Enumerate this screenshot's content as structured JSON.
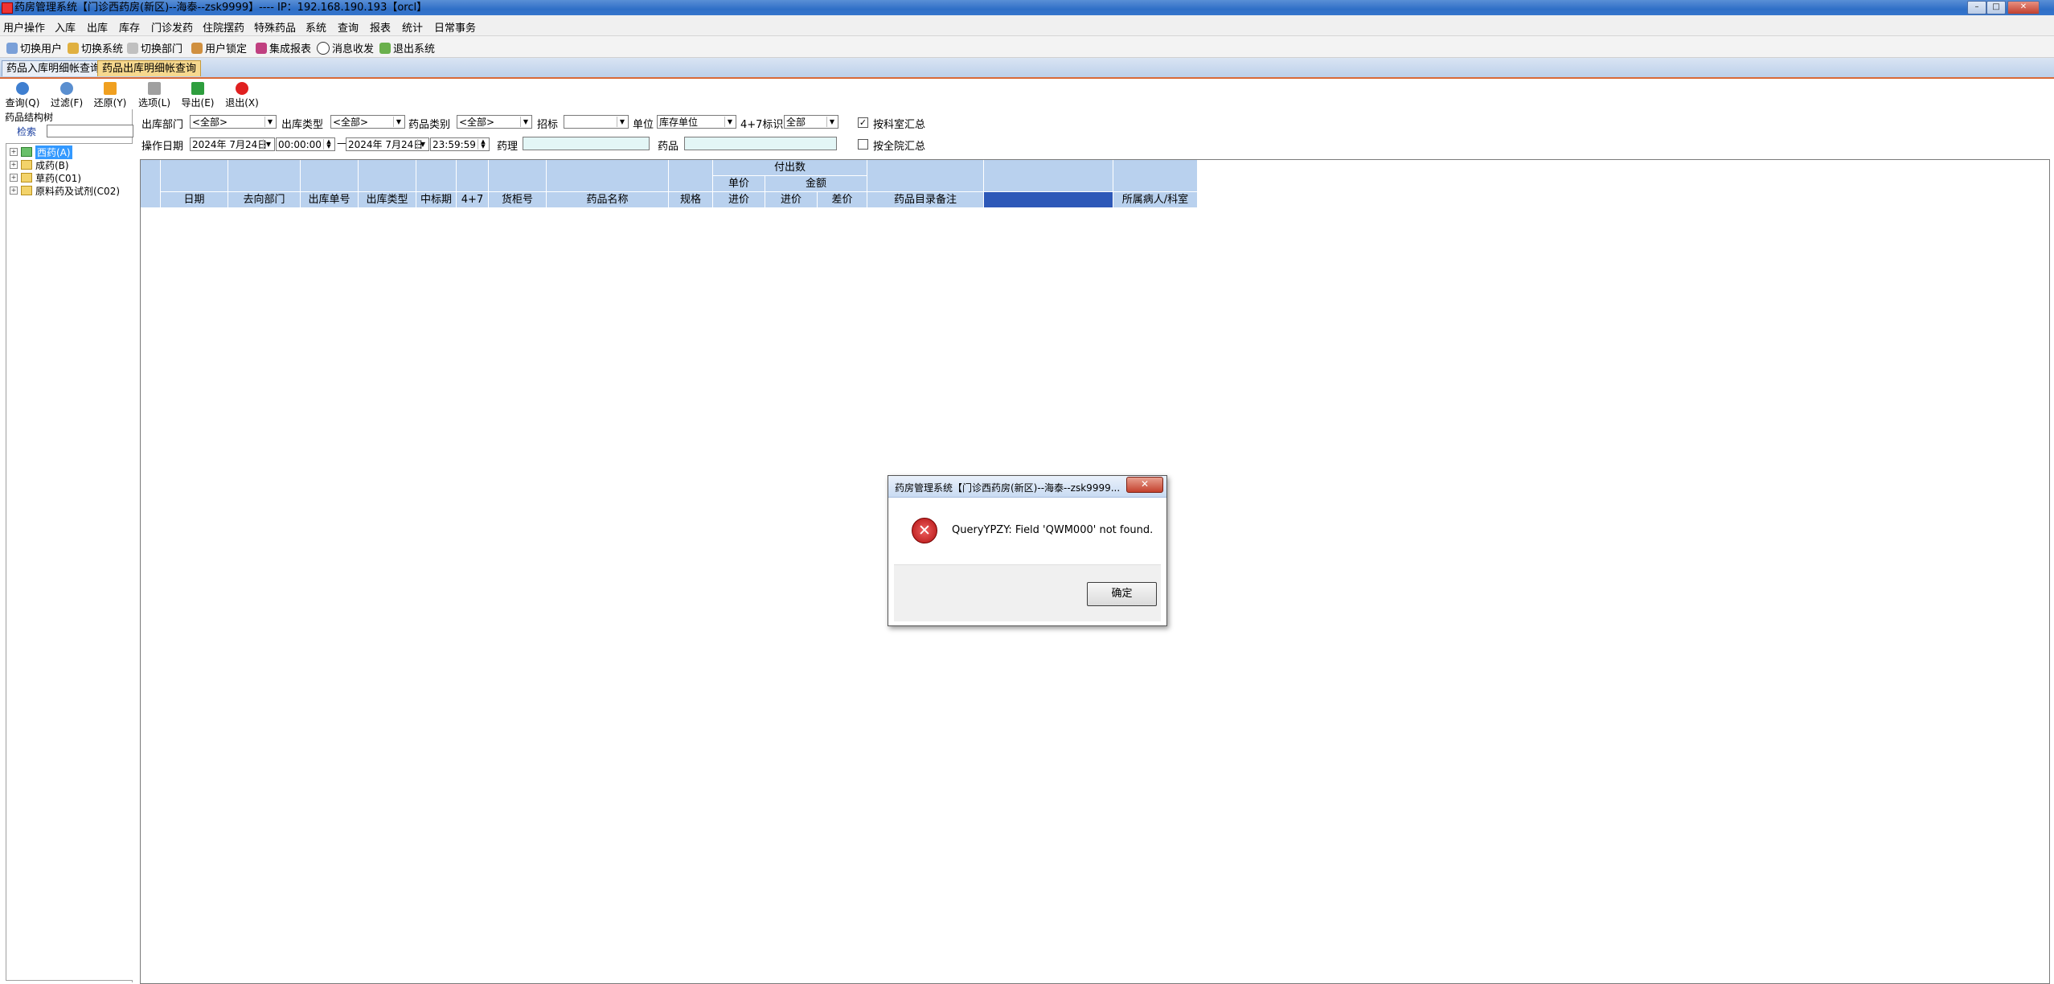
{
  "window": {
    "title": "药房管理系统【门诊西药房(新区)--海泰--zsk9999】---- IP：192.168.190.193【orcl】"
  },
  "menu": [
    "用户操作",
    "入库",
    "出库",
    "库存",
    "门诊发药",
    "住院摆药",
    "特殊药品",
    "系统",
    "查询",
    "报表",
    "统计",
    "日常事务"
  ],
  "toolbar": [
    "切换用户",
    "切换系统",
    "切换部门",
    "用户锁定",
    "集成报表",
    "消息收发",
    "退出系统"
  ],
  "tabs": [
    "药品入库明细帐查询",
    "药品出库明细帐查询"
  ],
  "actions": [
    "查询(Q)",
    "过滤(F)",
    "还原(Y)",
    "选项(L)",
    "导出(E)",
    "退出(X)"
  ],
  "left_panel": {
    "title": "药品结构树",
    "search_label": "检索",
    "tree": [
      "西药(A)",
      "成药(B)",
      "草药(C01)",
      "原料药及试剂(C02)"
    ]
  },
  "filters": {
    "out_dept_label": "出库部门",
    "out_dept_value": "<全部>",
    "out_type_label": "出库类型",
    "out_type_value": "<全部>",
    "drug_cat_label": "药品类别",
    "drug_cat_value": "<全部>",
    "bid_label": "招标",
    "bid_value": "",
    "unit_label": "单位",
    "unit_value": "库存单位",
    "flag_label": "4+7标识",
    "flag_value": "全部",
    "by_dept_label": "按科室汇总",
    "by_hospital_label": "按全院汇总",
    "op_date_label": "操作日期",
    "date_from": "2024年 7月24日",
    "time_from": "00:00:00",
    "dash": "—",
    "date_to": "2024年 7月24日",
    "time_to": "23:59:59",
    "pharm_label": "药理",
    "drug_label": "药品"
  },
  "grid": {
    "group_header": "付出数",
    "unit_price_header": "单价",
    "amount_header": "金额",
    "columns": [
      "日期",
      "去向部门",
      "出库单号",
      "出库类型",
      "中标期",
      "4+7",
      "货柜号",
      "药品名称",
      "规格",
      "进价",
      "进价",
      "差价",
      "药品目录备注",
      "",
      "所属病人/科室"
    ]
  },
  "dialog": {
    "title": "药房管理系统【门诊西药房(新区)--海泰--zsk9999...",
    "close_glyph": "✕",
    "message": "QueryYPZY: Field 'QWM000' not found.",
    "ok_label": "确定"
  }
}
